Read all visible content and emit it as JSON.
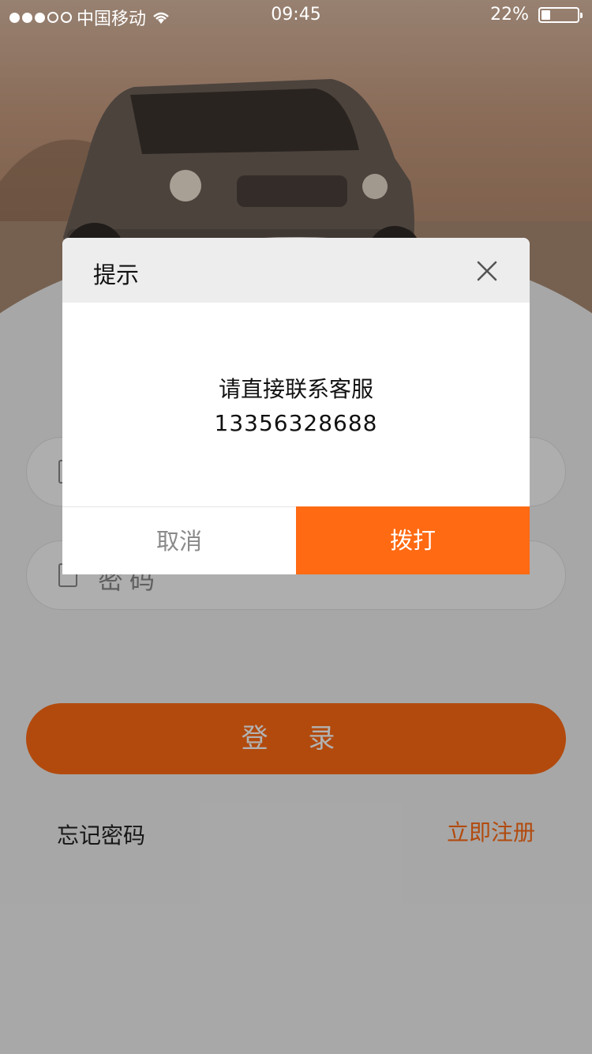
{
  "status_bar": {
    "carrier": "中国移动",
    "time": "09:45",
    "battery_percent": "22%",
    "battery_level": 0.22,
    "signal_dots_filled": 3,
    "signal_dots_total": 5
  },
  "login": {
    "username_placeholder": "",
    "password_placeholder": "密码",
    "login_button": "登 录",
    "forgot_password": "忘记密码",
    "register": "立即注册"
  },
  "dialog": {
    "title": "提示",
    "message_line1": "请直接联系客服",
    "message_line2": "13356328688",
    "cancel_label": "取消",
    "confirm_label": "拨打"
  },
  "colors": {
    "accent": "#ff6a13",
    "overlay": "rgba(0,0,0,0.30)"
  },
  "icons": {
    "close": "close-icon",
    "wifi": "wifi-icon",
    "battery": "battery-icon",
    "lock": "lock-icon",
    "user": "user-icon"
  }
}
